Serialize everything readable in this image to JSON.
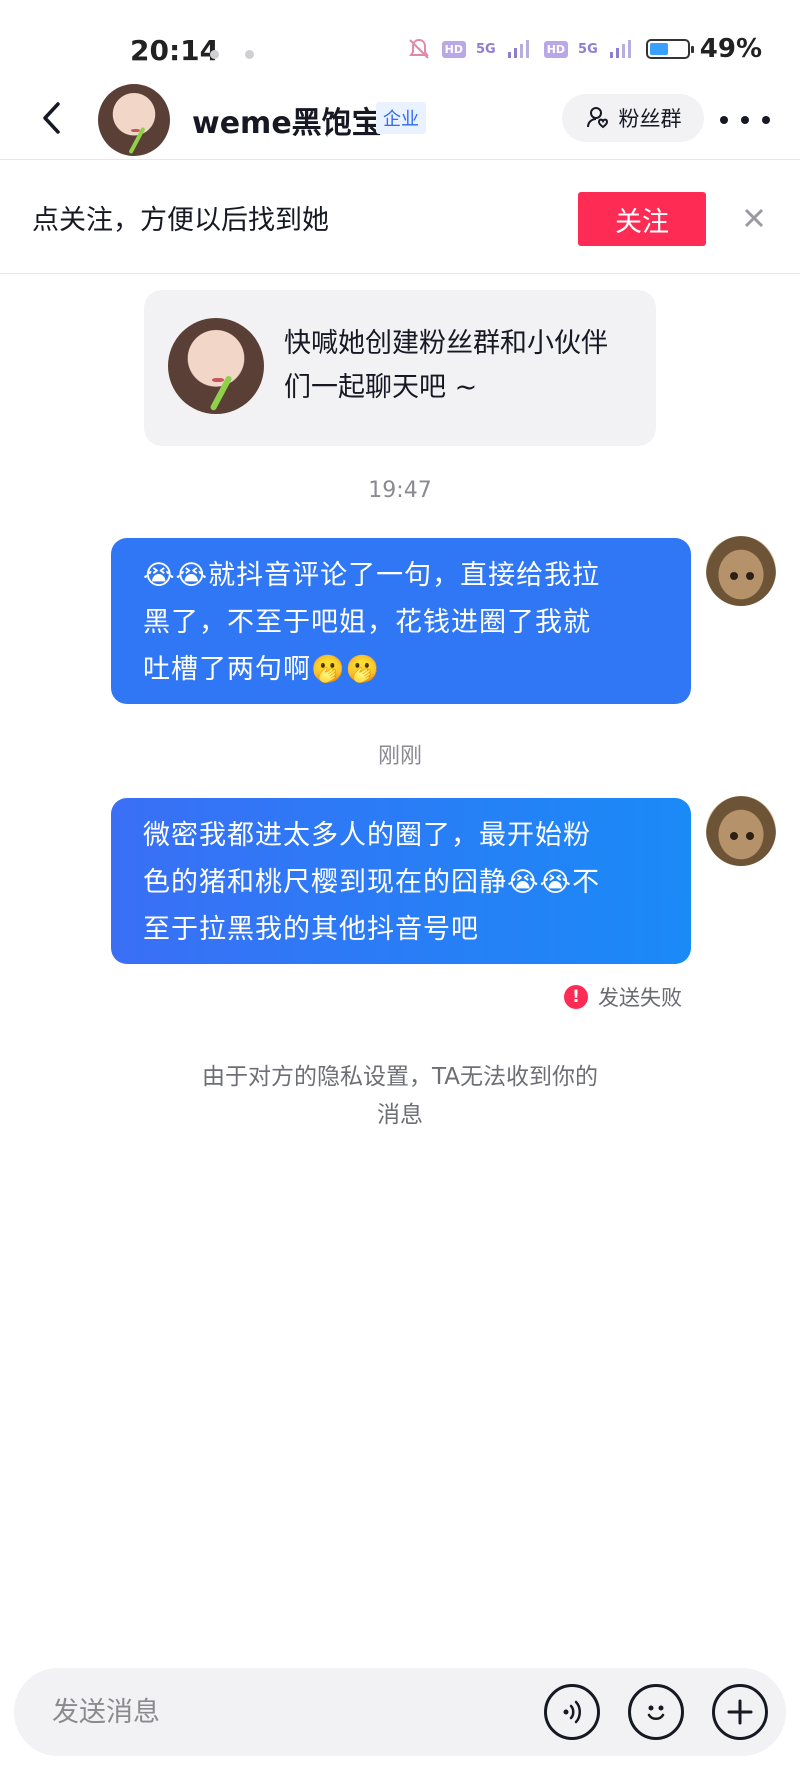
{
  "status_bar": {
    "time": "20:14",
    "network": "5G",
    "battery": "49%",
    "battery_level": 0.49
  },
  "header": {
    "contact_name": "weme黑饱宝",
    "badge": "企业",
    "fans_group_label": "粉丝群"
  },
  "follow_prompt": {
    "text": "点关注，方便以后找到她",
    "button": "关注"
  },
  "invite_card": {
    "text": "快喊她创建粉丝群和小伙伴们一起聊天吧 ~"
  },
  "messages": [
    {
      "timestamp": "19:47",
      "line1": "😭😭就抖音评论了一句，直接给我拉",
      "line2": "黑了，不至于吧姐，花钱进圈了我就",
      "line3": "吐槽了两句啊🫢🫢"
    },
    {
      "timestamp": "刚刚",
      "line1": "微密我都进太多人的圈了，最开始粉",
      "line2": "色的猪和桃尺樱到现在的囧静😭😭不",
      "line3": "至于拉黑我的其他抖音号吧",
      "status": "发送失败"
    }
  ],
  "privacy_note": {
    "line1": "由于对方的隐私设置，TA无法收到你的",
    "line2": "消息"
  },
  "input": {
    "placeholder": "发送消息"
  },
  "colors": {
    "accent_red": "#fe2c55",
    "bubble_blue": "#2f77f5",
    "badge_blue": "#2f6bf6"
  },
  "icons": [
    "back-arrow-icon",
    "fans-group-icon",
    "more-icon",
    "close-icon",
    "error-icon",
    "voice-icon",
    "emoji-icon",
    "plus-icon"
  ]
}
